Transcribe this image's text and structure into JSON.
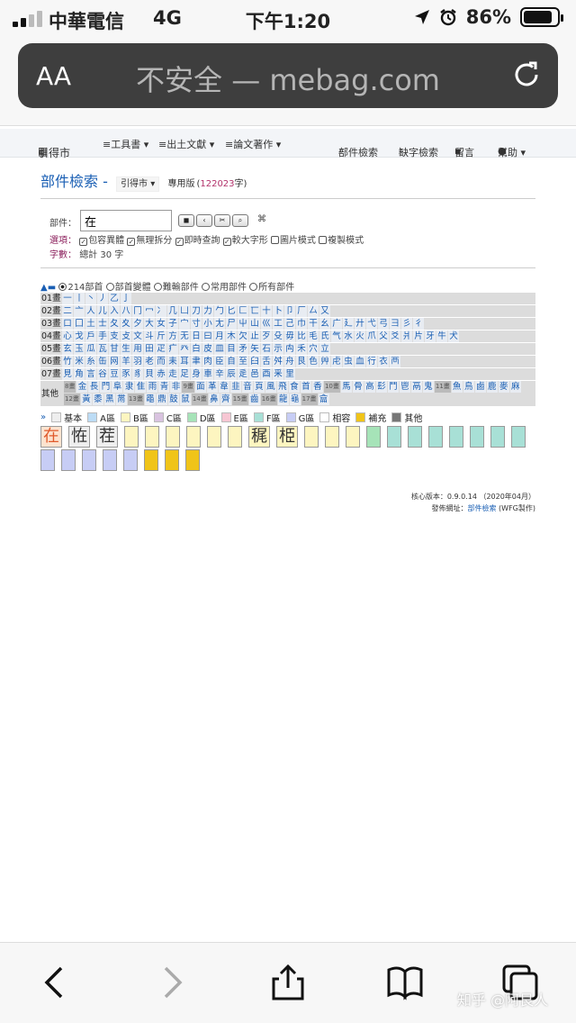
{
  "status": {
    "carrier": "中華電信",
    "network": "4G",
    "time": "下午1:20",
    "battery": "86%",
    "battery_level": 0.86
  },
  "browser": {
    "aa": "AA",
    "address": "不安全 — mebag.com"
  },
  "nav": {
    "logo": "引得市",
    "item1": "≡工具書 ▾",
    "item2": "≡出土文獻 ▾",
    "item3": "≡論文著作 ▾",
    "search": "部件檢索",
    "missing": "缺字檢索",
    "message": "留言",
    "help": "幫助 ▾"
  },
  "header": {
    "title": "部件檢索 -",
    "edition_btn": "引得市 ▾",
    "edition": "專用版",
    "count_open": "(",
    "count": "122023",
    "count_close": "字)"
  },
  "form": {
    "component_label": "部件：",
    "component_value": "在",
    "options_label": "選項：",
    "opt1": "包容異體",
    "opt2": "無理拆分",
    "opt3": "即時查詢",
    "opt4": "較大字形",
    "opt5": "圖片模式",
    "opt6": "複製模式",
    "total_label": "字數：",
    "total_value": "總計 30 字",
    "cmd": "⌘"
  },
  "radicals": {
    "r1": "214部首",
    "r2": "部首變體",
    "r3": "難輸部件",
    "r4": "常用部件",
    "r5": "所有部件"
  },
  "grid": {
    "rows": [
      {
        "label": "01畫",
        "cells": [
          "一",
          "丨",
          "丶",
          "丿",
          "乙",
          "亅"
        ]
      },
      {
        "label": "02畫",
        "cells": [
          "二",
          "亠",
          "人",
          "儿",
          "入",
          "八",
          "冂",
          "冖",
          "冫",
          "几",
          "凵",
          "刀",
          "力",
          "勹",
          "匕",
          "匚",
          "匸",
          "十",
          "卜",
          "卩",
          "厂",
          "厶",
          "又"
        ]
      },
      {
        "label": "03畫",
        "cells": [
          "口",
          "囗",
          "土",
          "士",
          "夂",
          "夊",
          "夕",
          "大",
          "女",
          "子",
          "宀",
          "寸",
          "小",
          "尢",
          "尸",
          "屮",
          "山",
          "巛",
          "工",
          "己",
          "巾",
          "干",
          "幺",
          "广",
          "廴",
          "廾",
          "弋",
          "弓",
          "彐",
          "彡",
          "彳"
        ]
      },
      {
        "label": "04畫",
        "cells": [
          "心",
          "戈",
          "戶",
          "手",
          "支",
          "攴",
          "文",
          "斗",
          "斤",
          "方",
          "无",
          "日",
          "曰",
          "月",
          "木",
          "欠",
          "止",
          "歹",
          "殳",
          "毋",
          "比",
          "毛",
          "氏",
          "气",
          "水",
          "火",
          "爪",
          "父",
          "爻",
          "爿",
          "片",
          "牙",
          "牛",
          "犬"
        ]
      },
      {
        "label": "05畫",
        "cells": [
          "玄",
          "玉",
          "瓜",
          "瓦",
          "甘",
          "生",
          "用",
          "田",
          "疋",
          "疒",
          "癶",
          "白",
          "皮",
          "皿",
          "目",
          "矛",
          "矢",
          "石",
          "示",
          "禸",
          "禾",
          "穴",
          "立"
        ]
      },
      {
        "label": "06畫",
        "cells": [
          "竹",
          "米",
          "糸",
          "缶",
          "网",
          "羊",
          "羽",
          "老",
          "而",
          "耒",
          "耳",
          "聿",
          "肉",
          "臣",
          "自",
          "至",
          "臼",
          "舌",
          "舛",
          "舟",
          "艮",
          "色",
          "艸",
          "虍",
          "虫",
          "血",
          "行",
          "衣",
          "襾"
        ]
      },
      {
        "label": "07畫",
        "cells": [
          "見",
          "角",
          "言",
          "谷",
          "豆",
          "豕",
          "豸",
          "貝",
          "赤",
          "走",
          "足",
          "身",
          "車",
          "辛",
          "辰",
          "辵",
          "邑",
          "酉",
          "釆",
          "里"
        ]
      }
    ],
    "other_label": "其他",
    "other_line1": [
      [
        "8畫",
        "金",
        "長",
        "門",
        "阜",
        "隶",
        "隹",
        "雨",
        "青",
        "非"
      ],
      [
        "9畫",
        "面",
        "革",
        "韋",
        "韭",
        "音",
        "頁",
        "風",
        "飛",
        "食",
        "首",
        "香"
      ],
      [
        "10畫",
        "馬",
        "骨",
        "高",
        "髟",
        "鬥",
        "鬯",
        "鬲",
        "鬼"
      ],
      [
        "11畫",
        "魚",
        "鳥",
        "鹵",
        "鹿",
        "麥",
        "麻"
      ]
    ],
    "other_line2": [
      [
        "12畫",
        "黃",
        "黍",
        "黑",
        "黹"
      ],
      [
        "13畫",
        "黽",
        "鼎",
        "鼓",
        "鼠"
      ],
      [
        "14畫",
        "鼻",
        "齊"
      ],
      [
        "15畫",
        "齒"
      ],
      [
        "16畫",
        "龍",
        "龜"
      ],
      [
        "17畫",
        "龠"
      ]
    ]
  },
  "legend": {
    "arrow": "»",
    "l1": "基本",
    "l2": "A區",
    "l3": "B區",
    "l4": "C區",
    "l5": "D區",
    "l6": "E區",
    "l7": "F區",
    "l8": "G區",
    "l9": "相容",
    "l10": "補充",
    "l11": "其他",
    "colors": [
      "#eeeeee",
      "#bcdcf5",
      "#fdf5c0",
      "#d9c3e0",
      "#a6e3b8",
      "#f7c6d3",
      "#a8e0d6",
      "#c7cdf5",
      "#ffffff",
      "#f0c419",
      "#777777"
    ]
  },
  "results": {
    "chars": [
      "在",
      "恠",
      "茬",
      "",
      "",
      "",
      "",
      "",
      "",
      "䅏",
      "栕",
      "",
      "",
      "",
      "",
      "",
      "",
      "",
      "",
      "",
      "",
      "",
      "",
      "",
      "",
      "",
      "",
      "",
      "",
      ""
    ],
    "colors": [
      "#fde3cf",
      "#eeeeee",
      "#eeeeee",
      "#fdf5c0",
      "#fdf5c0",
      "#fdf5c0",
      "#fdf5c0",
      "#fdf5c0",
      "#fdf5c0",
      "#fdf5c0",
      "#fdf5c0",
      "#fdf5c0",
      "#fdf5c0",
      "#fdf5c0",
      "#a6e3b8",
      "#a8e0d6",
      "#a8e0d6",
      "#a8e0d6",
      "#a8e0d6",
      "#a8e0d6",
      "#a8e0d6",
      "#a8e0d6",
      "#c7cdf5",
      "#c7cdf5",
      "#c7cdf5",
      "#c7cdf5",
      "#c7cdf5",
      "#f0c419",
      "#f0c419",
      "#f0c419"
    ],
    "first_color": "#e05a2b"
  },
  "footer": {
    "version": "核心版本：0.9.0.14 （2020年04月）",
    "pub_label": "發佈網址：",
    "pub_link": "部件檢索",
    "pub_suffix": "(WFG製作)"
  },
  "watermark": "知乎 @阿艮人"
}
